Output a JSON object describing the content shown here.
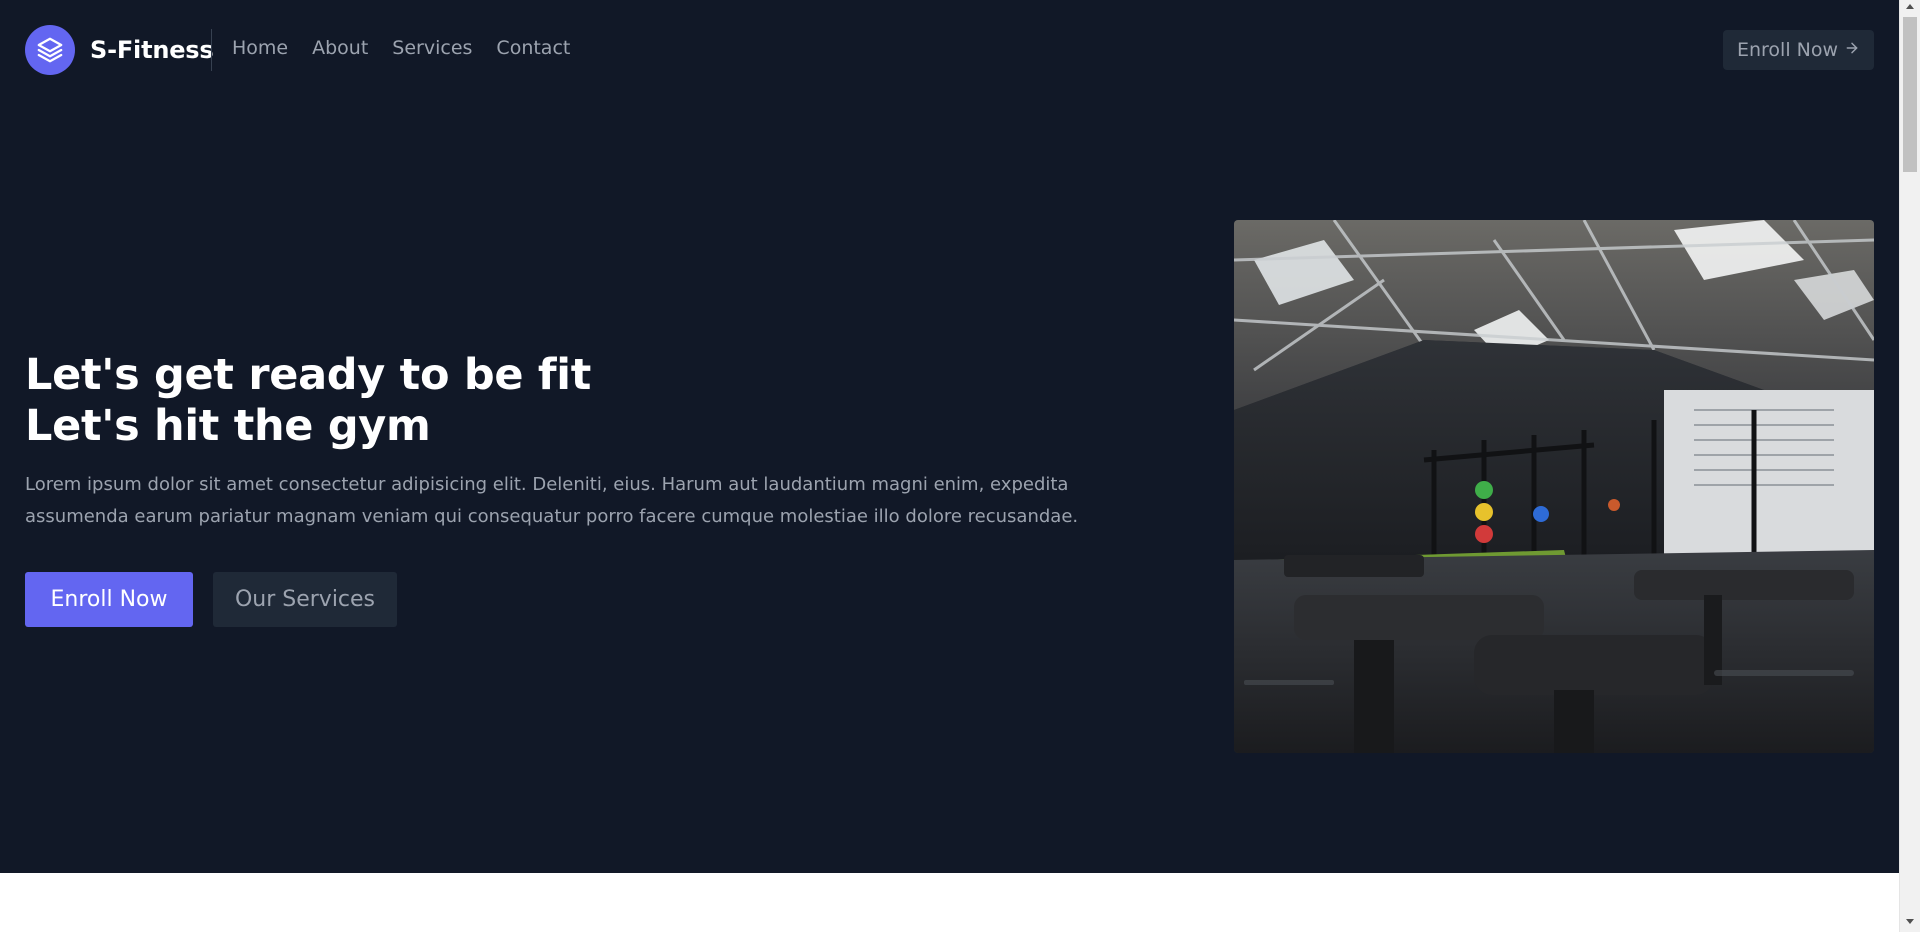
{
  "header": {
    "brand": "S-Fitness",
    "logo_icon": "layers-icon",
    "nav": [
      {
        "label": "Home"
      },
      {
        "label": "About"
      },
      {
        "label": "Services"
      },
      {
        "label": "Contact"
      }
    ],
    "cta_label": "Enroll Now",
    "cta_icon": "arrow-right-icon"
  },
  "hero": {
    "headline_line1": "Let's get ready to be fit",
    "headline_line2": "Let's hit the gym",
    "paragraph_line1": "Lorem ipsum dolor sit amet consectetur adipisicing elit. Deleniti, eius. Harum aut laudantium magni enim, expedita",
    "paragraph_line2": "assumenda earum pariatur magnam veniam qui consequatur porro facere cumque molestiae illo dolore recusandae.",
    "primary_button": "Enroll Now",
    "secondary_button": "Our Services",
    "image_alt": "gym interior photo"
  },
  "colors": {
    "hero_bg": "#111827",
    "accent": "#6366f1",
    "muted_text": "#9ca3af",
    "button_dark": "#1f2937"
  }
}
